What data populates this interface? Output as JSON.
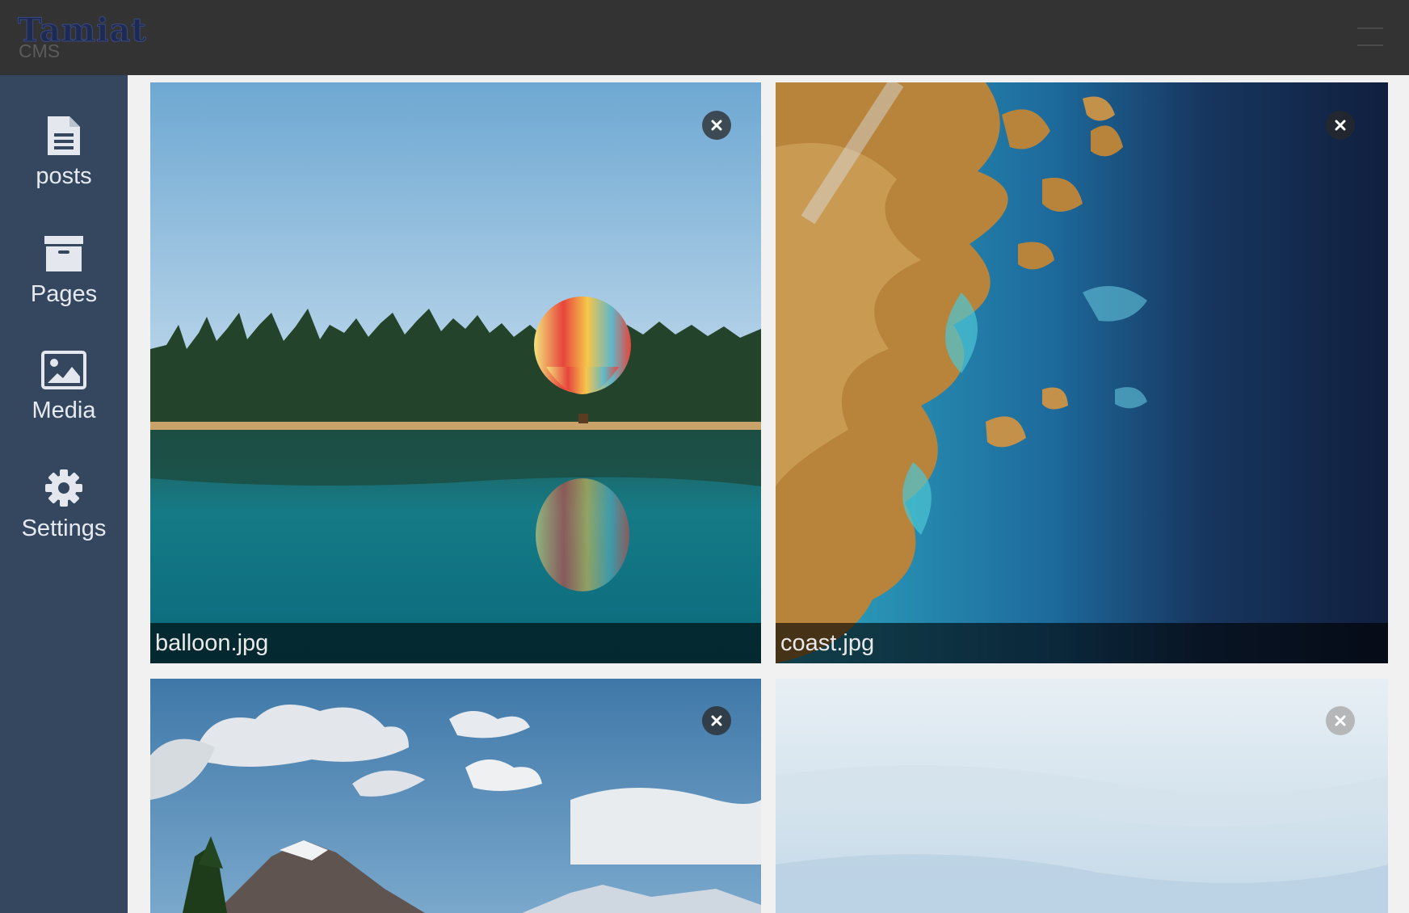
{
  "app": {
    "logo_title": "Tamiat",
    "logo_subtitle": "CMS"
  },
  "sidebar": {
    "items": [
      {
        "label": "posts",
        "icon": "file-text-icon"
      },
      {
        "label": "Pages",
        "icon": "archive-icon"
      },
      {
        "label": "Media",
        "icon": "image-icon"
      },
      {
        "label": "Settings",
        "icon": "gear-icon"
      }
    ]
  },
  "media": {
    "items": [
      {
        "filename": "balloon.jpg",
        "subject": "hot air balloon over lake"
      },
      {
        "filename": "coast.jpg",
        "subject": "satellite coast"
      },
      {
        "filename": "",
        "subject": "mountains and clouds"
      },
      {
        "filename": "",
        "subject": "cloudy sky"
      }
    ]
  },
  "colors": {
    "topbar": "#333333",
    "sidebar": "#34475f",
    "content_bg": "#f1f1f1"
  }
}
